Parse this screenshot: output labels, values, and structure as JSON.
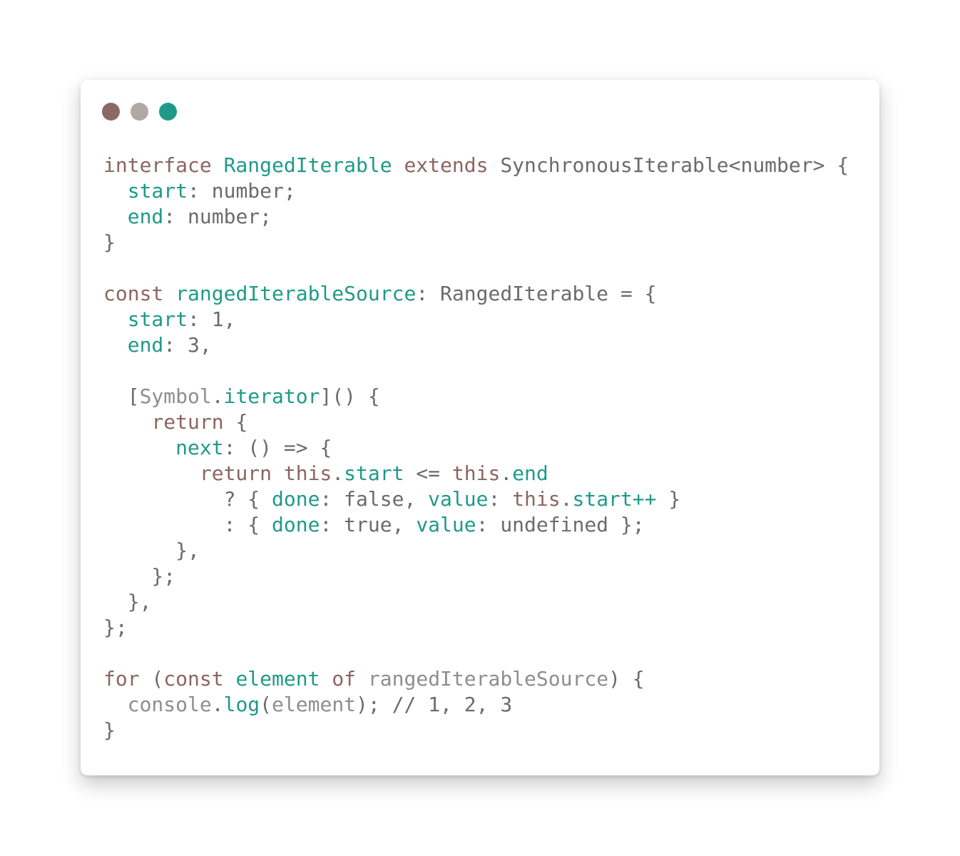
{
  "window": {
    "controls": [
      {
        "name": "close",
        "color": "#8c6a63"
      },
      {
        "name": "minimize",
        "color": "#b1a7a3"
      },
      {
        "name": "maximize",
        "color": "#1f9a88"
      }
    ]
  },
  "colors": {
    "keyword": "#8c6560",
    "identifier": "#1f9a88",
    "plain": "#6b6b6b",
    "muted": "#8e8e8e"
  },
  "code": {
    "lines": [
      [
        {
          "t": "interface ",
          "k": "keyword"
        },
        {
          "t": "RangedIterable",
          "k": "type-name"
        },
        {
          "t": " extends ",
          "k": "keyword"
        },
        {
          "t": "SynchronousIterable<number> {",
          "k": "plain"
        }
      ],
      [
        {
          "t": "  ",
          "k": "plain"
        },
        {
          "t": "start",
          "k": "property"
        },
        {
          "t": ": number;",
          "k": "plain"
        }
      ],
      [
        {
          "t": "  ",
          "k": "plain"
        },
        {
          "t": "end",
          "k": "property"
        },
        {
          "t": ": number;",
          "k": "plain"
        }
      ],
      [
        {
          "t": "}",
          "k": "plain"
        }
      ],
      [],
      [
        {
          "t": "const ",
          "k": "keyword"
        },
        {
          "t": "rangedIterableSource",
          "k": "type-name"
        },
        {
          "t": ": RangedIterable = {",
          "k": "plain"
        }
      ],
      [
        {
          "t": "  ",
          "k": "plain"
        },
        {
          "t": "start",
          "k": "property"
        },
        {
          "t": ": 1,",
          "k": "plain"
        }
      ],
      [
        {
          "t": "  ",
          "k": "plain"
        },
        {
          "t": "end",
          "k": "property"
        },
        {
          "t": ": 3,",
          "k": "plain"
        }
      ],
      [],
      [
        {
          "t": "  [",
          "k": "plain"
        },
        {
          "t": "Symbol",
          "k": "muted"
        },
        {
          "t": ".",
          "k": "plain"
        },
        {
          "t": "iterator",
          "k": "property"
        },
        {
          "t": "]() {",
          "k": "plain"
        }
      ],
      [
        {
          "t": "    ",
          "k": "plain"
        },
        {
          "t": "return",
          "k": "keyword"
        },
        {
          "t": " {",
          "k": "plain"
        }
      ],
      [
        {
          "t": "      ",
          "k": "plain"
        },
        {
          "t": "next",
          "k": "property"
        },
        {
          "t": ": () => {",
          "k": "plain"
        }
      ],
      [
        {
          "t": "        ",
          "k": "plain"
        },
        {
          "t": "return this",
          "k": "keyword"
        },
        {
          "t": ".",
          "k": "plain"
        },
        {
          "t": "start",
          "k": "property"
        },
        {
          "t": " <= ",
          "k": "plain"
        },
        {
          "t": "this",
          "k": "keyword"
        },
        {
          "t": ".",
          "k": "plain"
        },
        {
          "t": "end",
          "k": "property"
        }
      ],
      [
        {
          "t": "          ? { ",
          "k": "plain"
        },
        {
          "t": "done",
          "k": "property"
        },
        {
          "t": ": false, ",
          "k": "plain"
        },
        {
          "t": "value",
          "k": "property"
        },
        {
          "t": ": ",
          "k": "plain"
        },
        {
          "t": "this",
          "k": "keyword"
        },
        {
          "t": ".",
          "k": "plain"
        },
        {
          "t": "start++",
          "k": "property"
        },
        {
          "t": " }",
          "k": "plain"
        }
      ],
      [
        {
          "t": "          : { ",
          "k": "plain"
        },
        {
          "t": "done",
          "k": "property"
        },
        {
          "t": ": true, ",
          "k": "plain"
        },
        {
          "t": "value",
          "k": "property"
        },
        {
          "t": ": undefined };",
          "k": "plain"
        }
      ],
      [
        {
          "t": "      },",
          "k": "plain"
        }
      ],
      [
        {
          "t": "    };",
          "k": "plain"
        }
      ],
      [
        {
          "t": "  },",
          "k": "plain"
        }
      ],
      [
        {
          "t": "};",
          "k": "plain"
        }
      ],
      [],
      [
        {
          "t": "for",
          "k": "keyword"
        },
        {
          "t": " (",
          "k": "plain"
        },
        {
          "t": "const ",
          "k": "keyword"
        },
        {
          "t": "element",
          "k": "type-name"
        },
        {
          "t": " of ",
          "k": "keyword"
        },
        {
          "t": "rangedIterableSource",
          "k": "muted"
        },
        {
          "t": ") {",
          "k": "plain"
        }
      ],
      [
        {
          "t": "  ",
          "k": "plain"
        },
        {
          "t": "console",
          "k": "muted"
        },
        {
          "t": ".",
          "k": "plain"
        },
        {
          "t": "log",
          "k": "property"
        },
        {
          "t": "(",
          "k": "plain"
        },
        {
          "t": "element",
          "k": "muted"
        },
        {
          "t": "); // 1, 2, 3",
          "k": "plain"
        }
      ],
      [
        {
          "t": "}",
          "k": "plain"
        }
      ]
    ]
  }
}
